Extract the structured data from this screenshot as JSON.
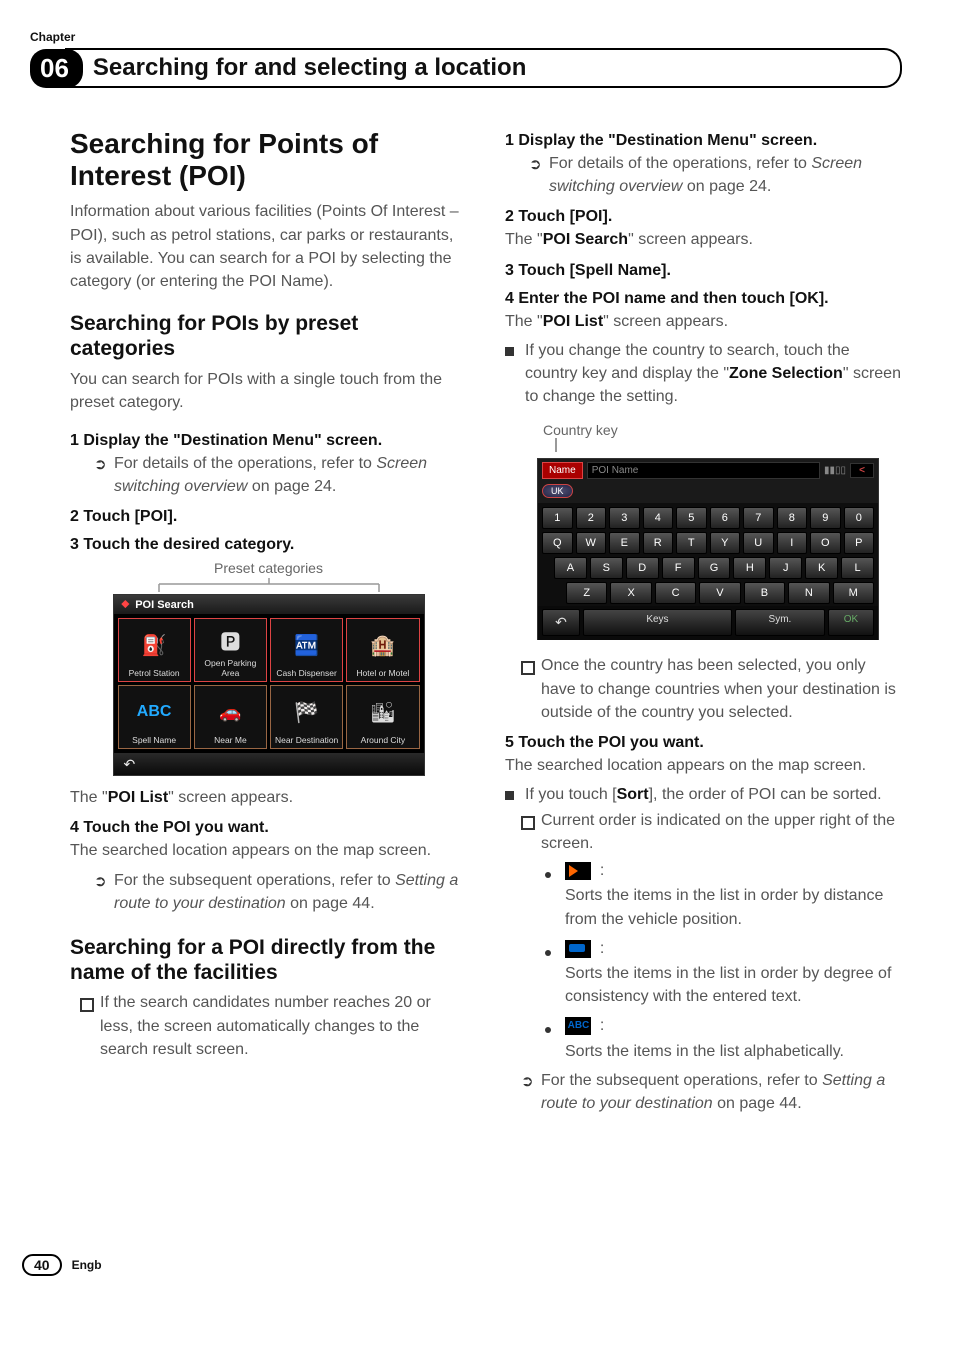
{
  "chapter_label": "Chapter",
  "chapter_number": "06",
  "chapter_title": "Searching for and selecting a location",
  "left": {
    "h1": "Searching for Points of Interest (POI)",
    "intro": "Information about various facilities (Points Of Interest – POI), such as petrol stations, car parks or restaurants, is available. You can search for a POI by selecting the category (or entering the POI Name).",
    "h2a": "Searching for POIs by preset categories",
    "h2a_body": "You can search for POIs with a single touch from the preset category.",
    "step1": "1    Display the \"Destination Menu\" screen.",
    "step1_sub_a": "For details of the operations, refer to ",
    "step1_sub_b": "Screen switching overview",
    "step1_sub_c": " on page 24.",
    "step2": "2    Touch [POI].",
    "step3": "3    Touch the desired category.",
    "caption_preset": "Preset categories",
    "poi": {
      "title_icon": "⬥",
      "title": "POI Search",
      "cells": {
        "petrol": "Petrol Station",
        "parking": "Open Parking Area",
        "cash": "Cash Dispenser",
        "hotel": "Hotel or Motel",
        "spell": "Spell Name",
        "abc_icon": "ABC",
        "nearme": "Near Me",
        "neardest": "Near Destination",
        "around": "Around City"
      },
      "back": "↶"
    },
    "after3": "The \"",
    "after3_b": "POI List",
    "after3_c": "\" screen appears.",
    "step4": "4    Touch the POI you want.",
    "step4_after": "The searched location appears on the map screen.",
    "step4_sub_a": "For the subsequent operations, refer to ",
    "step4_sub_b": "Setting a route to your destination",
    "step4_sub_c": " on page 44.",
    "h2b": "Searching for a POI directly from the name of the facilities",
    "h2b_sub": "If the search candidates number reaches 20 or less, the screen automatically changes to the search result screen."
  },
  "right": {
    "step1": "1    Display the \"Destination Menu\" screen.",
    "step1_sub_a": "For details of the operations, refer to ",
    "step1_sub_b": "Screen switching overview",
    "step1_sub_c": " on page 24.",
    "step2": "2    Touch [POI].",
    "step2_after_a": "The \"",
    "step2_after_b": "POI Search",
    "step2_after_c": "\" screen appears.",
    "step3": "3    Touch [Spell Name].",
    "step4": "4    Enter the POI name and then touch [OK].",
    "step4_after_a": "The \"",
    "step4_after_b": "POI List",
    "step4_after_c": "\" screen appears.",
    "step4_bullet_a": "If you change the country to search, touch the country key and display the \"",
    "step4_bullet_b": "Zone Selection",
    "step4_bullet_c": "\" screen to change the setting.",
    "caption_country": "Country key",
    "kbd": {
      "tab": "Name",
      "placeholder": "POI Name",
      "progress": "▮▮▯▯",
      "del": "<",
      "uk": "UK",
      "row1": [
        "1",
        "2",
        "3",
        "4",
        "5",
        "6",
        "7",
        "8",
        "9",
        "0"
      ],
      "row2": [
        "Q",
        "W",
        "E",
        "R",
        "T",
        "Y",
        "U",
        "I",
        "O",
        "P"
      ],
      "row3": [
        "A",
        "S",
        "D",
        "F",
        "G",
        "H",
        "J",
        "K",
        "L"
      ],
      "row4": [
        "Z",
        "X",
        "C",
        "V",
        "B",
        "N",
        "M"
      ],
      "back": "↶",
      "keys": "Keys",
      "sym": "Sym.",
      "ok": "OK"
    },
    "note_once": "Once the country has been selected, you only have to change countries when your destination is outside of the country you selected.",
    "step5": "5    Touch the POI you want.",
    "step5_after": "The searched location appears on the map screen.",
    "sort_bullet_a": "If you touch [",
    "sort_bullet_b": "Sort",
    "sort_bullet_c": "], the order of POI can be sorted.",
    "sort_current": "Current order is indicated on the upper right of the screen.",
    "sort_colon": ":",
    "sort_dist": "Sorts the items in the list in order by distance from the vehicle position.",
    "sort_cons": "Sorts the items in the list in order by degree of consistency with the entered text.",
    "sort_alpha_icon": "ABC",
    "sort_alpha": "Sorts the items in the list alphabetically.",
    "subseq_a": "For the subsequent operations, refer to ",
    "subseq_b": "Setting a route to your destination",
    "subseq_c": " on page 44."
  },
  "footer": {
    "page": "40",
    "lang": "Engb"
  }
}
